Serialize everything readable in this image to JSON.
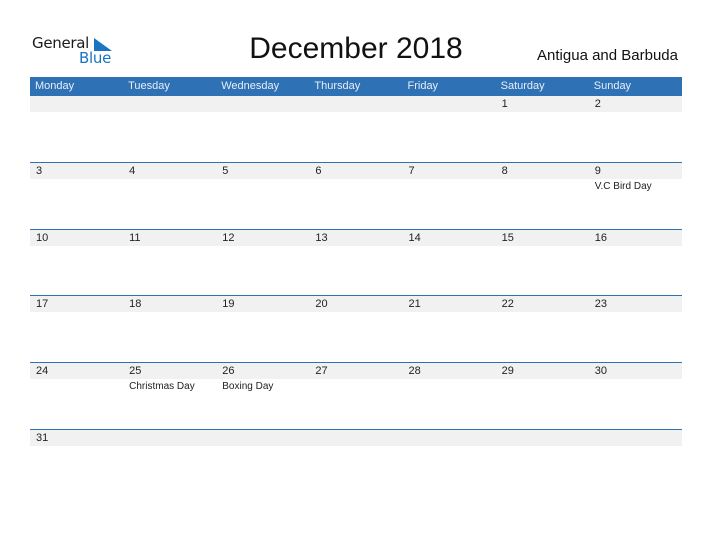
{
  "logo": {
    "word1": "General",
    "word2": "Blue",
    "icon": "triangle-flag-icon",
    "brand_color": "#1a74c2"
  },
  "title": "December 2018",
  "country": "Antigua and Barbuda",
  "colors": {
    "header_bg": "#2e72b5",
    "strip_bg": "#f1f1f1"
  },
  "days": [
    "Monday",
    "Tuesday",
    "Wednesday",
    "Thursday",
    "Friday",
    "Saturday",
    "Sunday"
  ],
  "weeks": [
    [
      {
        "d": "",
        "h": ""
      },
      {
        "d": "",
        "h": ""
      },
      {
        "d": "",
        "h": ""
      },
      {
        "d": "",
        "h": ""
      },
      {
        "d": "",
        "h": ""
      },
      {
        "d": "1",
        "h": ""
      },
      {
        "d": "2",
        "h": ""
      }
    ],
    [
      {
        "d": "3",
        "h": ""
      },
      {
        "d": "4",
        "h": ""
      },
      {
        "d": "5",
        "h": ""
      },
      {
        "d": "6",
        "h": ""
      },
      {
        "d": "7",
        "h": ""
      },
      {
        "d": "8",
        "h": ""
      },
      {
        "d": "9",
        "h": "V.C Bird Day"
      }
    ],
    [
      {
        "d": "10",
        "h": ""
      },
      {
        "d": "11",
        "h": ""
      },
      {
        "d": "12",
        "h": ""
      },
      {
        "d": "13",
        "h": ""
      },
      {
        "d": "14",
        "h": ""
      },
      {
        "d": "15",
        "h": ""
      },
      {
        "d": "16",
        "h": ""
      }
    ],
    [
      {
        "d": "17",
        "h": ""
      },
      {
        "d": "18",
        "h": ""
      },
      {
        "d": "19",
        "h": ""
      },
      {
        "d": "20",
        "h": ""
      },
      {
        "d": "21",
        "h": ""
      },
      {
        "d": "22",
        "h": ""
      },
      {
        "d": "23",
        "h": ""
      }
    ],
    [
      {
        "d": "24",
        "h": ""
      },
      {
        "d": "25",
        "h": "Christmas Day"
      },
      {
        "d": "26",
        "h": "Boxing Day"
      },
      {
        "d": "27",
        "h": ""
      },
      {
        "d": "28",
        "h": ""
      },
      {
        "d": "29",
        "h": ""
      },
      {
        "d": "30",
        "h": ""
      }
    ],
    [
      {
        "d": "31",
        "h": ""
      },
      {
        "d": "",
        "h": ""
      },
      {
        "d": "",
        "h": ""
      },
      {
        "d": "",
        "h": ""
      },
      {
        "d": "",
        "h": ""
      },
      {
        "d": "",
        "h": ""
      },
      {
        "d": "",
        "h": ""
      }
    ]
  ]
}
